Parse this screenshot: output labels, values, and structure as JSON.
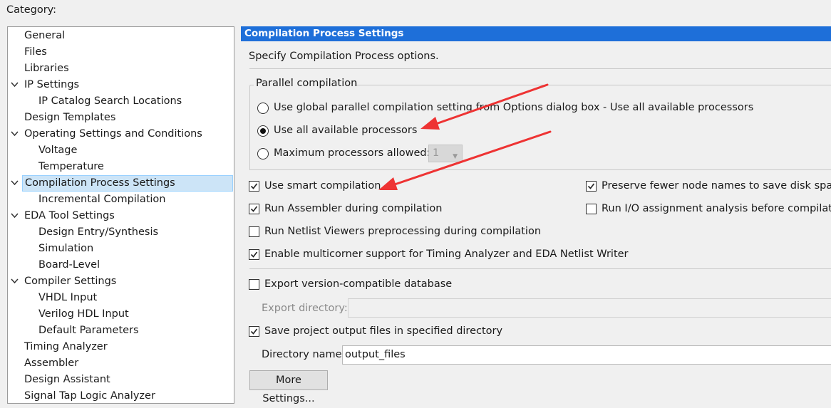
{
  "category_label": "Category:",
  "tree": [
    {
      "label": "General",
      "level": 0,
      "expandable": false,
      "selected": false
    },
    {
      "label": "Files",
      "level": 0,
      "expandable": false,
      "selected": false
    },
    {
      "label": "Libraries",
      "level": 0,
      "expandable": false,
      "selected": false
    },
    {
      "label": "IP Settings",
      "level": 0,
      "expandable": true,
      "selected": false
    },
    {
      "label": "IP Catalog Search Locations",
      "level": 1,
      "expandable": false,
      "selected": false
    },
    {
      "label": "Design Templates",
      "level": 0,
      "expandable": false,
      "selected": false
    },
    {
      "label": "Operating Settings and Conditions",
      "level": 0,
      "expandable": true,
      "selected": false
    },
    {
      "label": "Voltage",
      "level": 1,
      "expandable": false,
      "selected": false
    },
    {
      "label": "Temperature",
      "level": 1,
      "expandable": false,
      "selected": false
    },
    {
      "label": "Compilation Process Settings",
      "level": 0,
      "expandable": true,
      "selected": true
    },
    {
      "label": "Incremental Compilation",
      "level": 1,
      "expandable": false,
      "selected": false
    },
    {
      "label": "EDA Tool Settings",
      "level": 0,
      "expandable": true,
      "selected": false
    },
    {
      "label": "Design Entry/Synthesis",
      "level": 1,
      "expandable": false,
      "selected": false
    },
    {
      "label": "Simulation",
      "level": 1,
      "expandable": false,
      "selected": false
    },
    {
      "label": "Board-Level",
      "level": 1,
      "expandable": false,
      "selected": false
    },
    {
      "label": "Compiler Settings",
      "level": 0,
      "expandable": true,
      "selected": false
    },
    {
      "label": "VHDL Input",
      "level": 1,
      "expandable": false,
      "selected": false
    },
    {
      "label": "Verilog HDL Input",
      "level": 1,
      "expandable": false,
      "selected": false
    },
    {
      "label": "Default Parameters",
      "level": 1,
      "expandable": false,
      "selected": false
    },
    {
      "label": "Timing Analyzer",
      "level": 0,
      "expandable": false,
      "selected": false
    },
    {
      "label": "Assembler",
      "level": 0,
      "expandable": false,
      "selected": false
    },
    {
      "label": "Design Assistant",
      "level": 0,
      "expandable": false,
      "selected": false
    },
    {
      "label": "Signal Tap Logic Analyzer",
      "level": 0,
      "expandable": false,
      "selected": false
    }
  ],
  "panel": {
    "title": "Compilation Process Settings",
    "description": "Specify Compilation Process options.",
    "parallel_group_label": "Parallel compilation",
    "radio_options": [
      {
        "label": "Use global parallel compilation setting from Options dialog box - Use all available processors",
        "checked": false
      },
      {
        "label": "Use all available processors",
        "checked": true
      },
      {
        "label": "Maximum processors allowed:",
        "checked": false
      }
    ],
    "max_processors_value": "1",
    "checkboxes": {
      "smart_compilation": {
        "label": "Use smart compilation",
        "checked": true
      },
      "preserve_fewer_nodes": {
        "label": "Preserve fewer node names to save disk space",
        "checked": true
      },
      "run_assembler": {
        "label": "Run Assembler during compilation",
        "checked": true
      },
      "run_io_analysis": {
        "label": "Run I/O assignment analysis before compilation",
        "checked": false
      },
      "netlist_viewers": {
        "label": "Run Netlist Viewers preprocessing during compilation",
        "checked": false
      },
      "multicorner": {
        "label": "Enable multicorner support for Timing Analyzer and EDA Netlist Writer",
        "checked": true
      },
      "export_database": {
        "label": "Export version-compatible database",
        "checked": false
      },
      "save_output_files": {
        "label": "Save project output files in specified directory",
        "checked": true
      }
    },
    "export_directory_label": "Export directory:",
    "export_directory_value": "",
    "directory_name_label": "Directory name:",
    "directory_name_value": "output_files",
    "more_settings_label": "More Settings..."
  },
  "colors": {
    "header_bg": "#1e6fd9",
    "selection_bg": "#cce4f7",
    "annotation_arrow": "#ee3333"
  }
}
